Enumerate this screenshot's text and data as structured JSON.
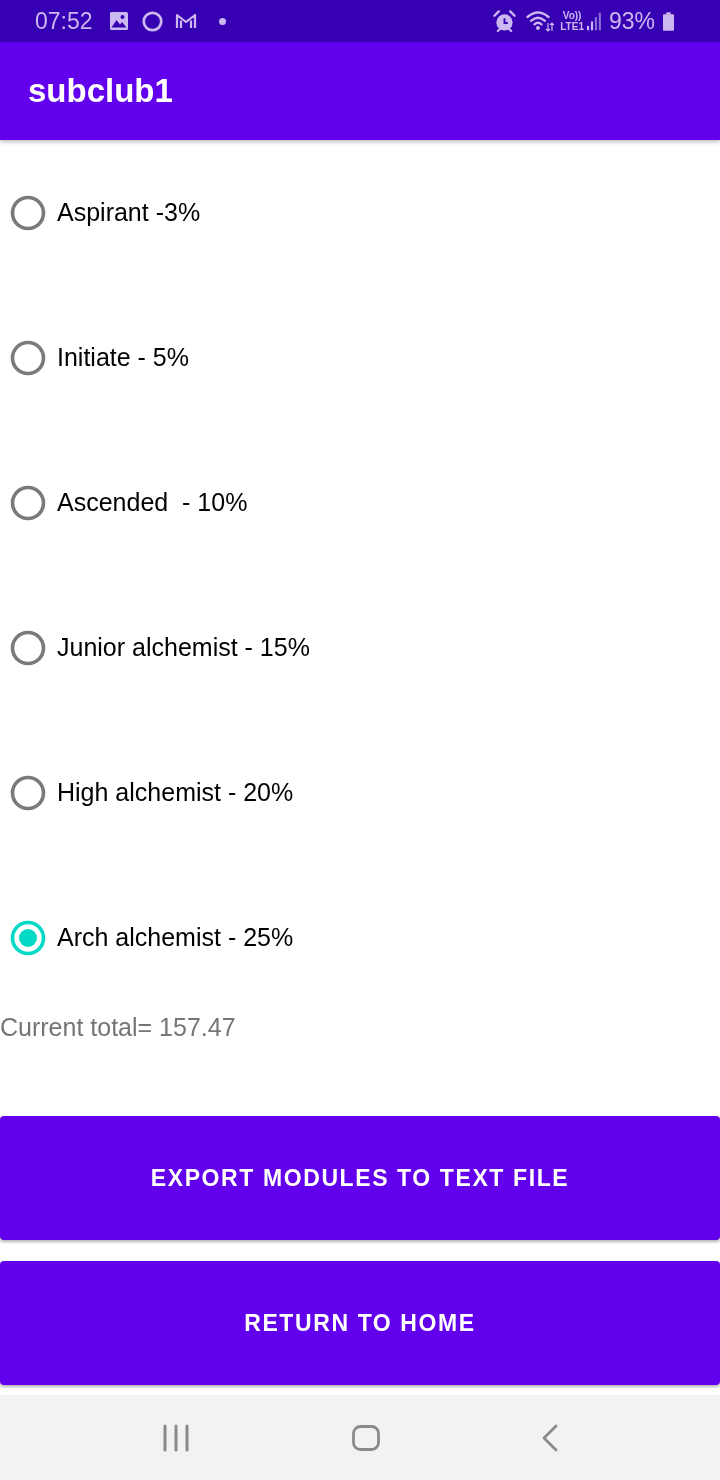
{
  "status_bar": {
    "time": "07:52",
    "network_top": "Vo))",
    "network_bottom": "LTE1",
    "battery": "93%"
  },
  "app_bar": {
    "title": "subclub1"
  },
  "options": [
    {
      "label": "Aspirant -3%",
      "selected": false
    },
    {
      "label": "Initiate - 5%",
      "selected": false
    },
    {
      "label": "Ascended  - 10%",
      "selected": false
    },
    {
      "label": "Junior alchemist - 15%",
      "selected": false
    },
    {
      "label": "High alchemist - 20%",
      "selected": false
    },
    {
      "label": "Arch alchemist - 25%",
      "selected": true
    }
  ],
  "total": "Current total= 157.47",
  "buttons": [
    "EXPORT MODULES TO TEXT FILE",
    "RETURN TO HOME"
  ]
}
